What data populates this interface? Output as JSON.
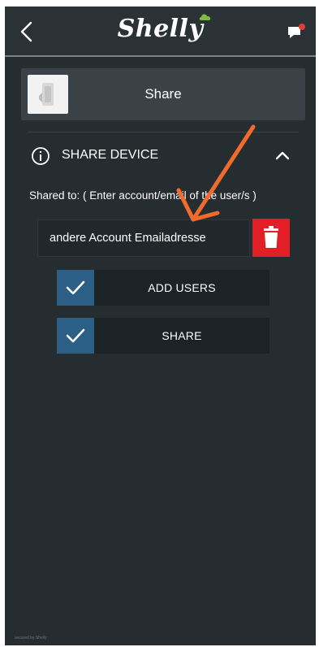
{
  "header": {
    "logo_text": "Shelly",
    "notification_color": "#e53935"
  },
  "share_bar": {
    "title": "Share"
  },
  "section": {
    "title": "SHARE DEVICE",
    "hint": "Shared to: ( Enter account/email of the user/s )"
  },
  "email_field": {
    "value": "andere Account Emailadresse"
  },
  "buttons": {
    "add_users": "ADD USERS",
    "share": "SHARE"
  },
  "footer": {
    "note": "secured by Shelly"
  },
  "colors": {
    "background": "#252d31",
    "checkbox": "#2b5f86",
    "delete": "#e21f26",
    "annotation_arrow": "#f26b2d"
  },
  "icons": [
    "back-arrow-icon",
    "shelly-logo",
    "chat-notification-icon",
    "device-thumbnail",
    "info-icon",
    "chevron-up-icon",
    "trash-icon",
    "checkmark-icon",
    "annotation-arrow"
  ]
}
